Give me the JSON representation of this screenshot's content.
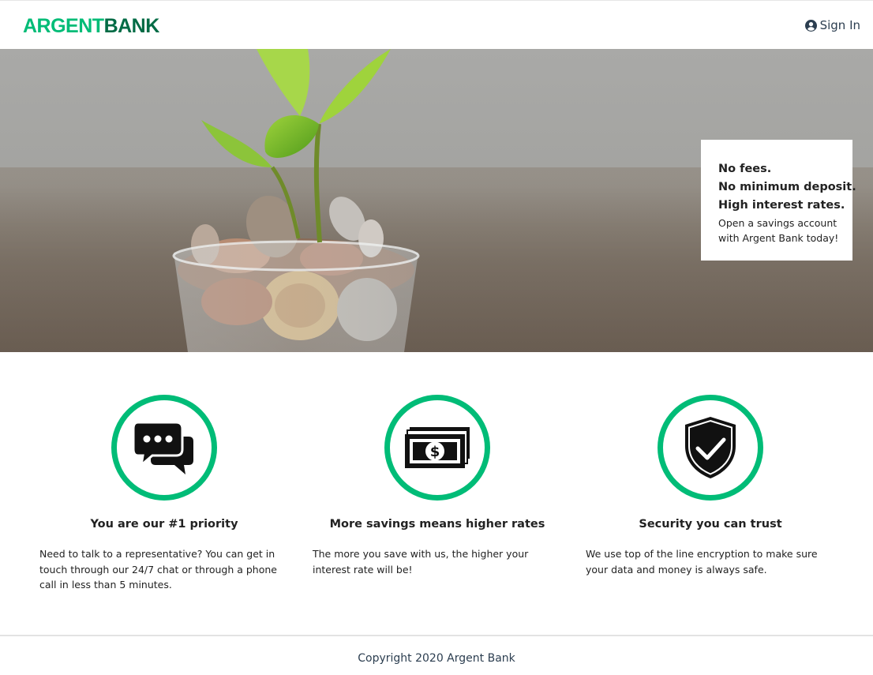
{
  "header": {
    "logo_part1": "ARGENT",
    "logo_part2": "BANK",
    "signin_label": "Sign In",
    "icon": "user-circle-icon"
  },
  "hero": {
    "subtitles": [
      "No fees.",
      "No minimum deposit.",
      "High interest rates."
    ],
    "text": "Open a savings account with Argent Bank today!"
  },
  "features": [
    {
      "icon": "chat-icon",
      "title": "You are our #1 priority",
      "text": "Need to talk to a representative? You can get in touch through our 24/7 chat or through a phone call in less than 5 minutes."
    },
    {
      "icon": "money-icon",
      "title": "More savings means higher rates",
      "text": "The more you save with us, the higher your interest rate will be!"
    },
    {
      "icon": "security-shield-icon",
      "title": "Security you can trust",
      "text": "We use top of the line encryption to make sure your data and money is always safe."
    }
  ],
  "footer": {
    "copyright": "Copyright 2020 Argent Bank"
  },
  "colors": {
    "brand_green": "#00bc77",
    "brand_dark_green": "#006b45",
    "text": "#2c3e50"
  }
}
